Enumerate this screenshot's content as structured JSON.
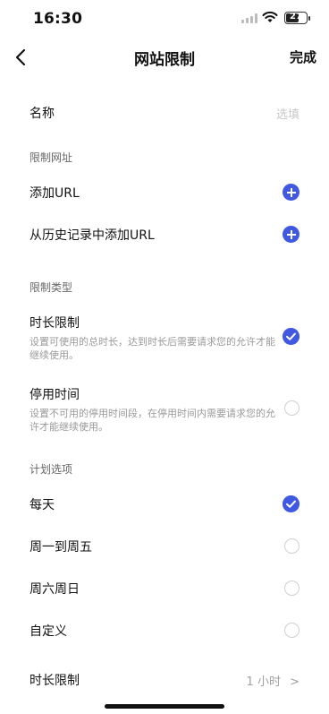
{
  "status": {
    "time": "16:30",
    "battery": "27"
  },
  "nav": {
    "title": "网站限制",
    "done": "完成",
    "back_icon": "chevron-left-icon"
  },
  "name": {
    "label": "名称",
    "placeholder": "选填"
  },
  "url_section": {
    "header": "限制网址",
    "add_url": "添加URL",
    "add_from_history": "从历史记录中添加URL"
  },
  "type_section": {
    "header": "限制类型",
    "duration": {
      "label": "时长限制",
      "desc": "设置可使用的总时长，达到时长后需要请求您的允许才能继续使用。",
      "selected": true
    },
    "downtime": {
      "label": "停用时间",
      "desc": "设置不可用的停用时间段，在停用时间内需要请求您的允许才能继续使用。",
      "selected": false
    }
  },
  "plan_section": {
    "header": "计划选项",
    "options": [
      {
        "label": "每天",
        "selected": true
      },
      {
        "label": "周一到周五",
        "selected": false
      },
      {
        "label": "周六周日",
        "selected": false
      },
      {
        "label": "自定义",
        "selected": false
      }
    ]
  },
  "limit": {
    "label": "时长限制",
    "value": "1 小时",
    "chevron": ">"
  },
  "colors": {
    "accent": "#4059e0",
    "text": "#111111",
    "muted": "#9a9a9a"
  }
}
